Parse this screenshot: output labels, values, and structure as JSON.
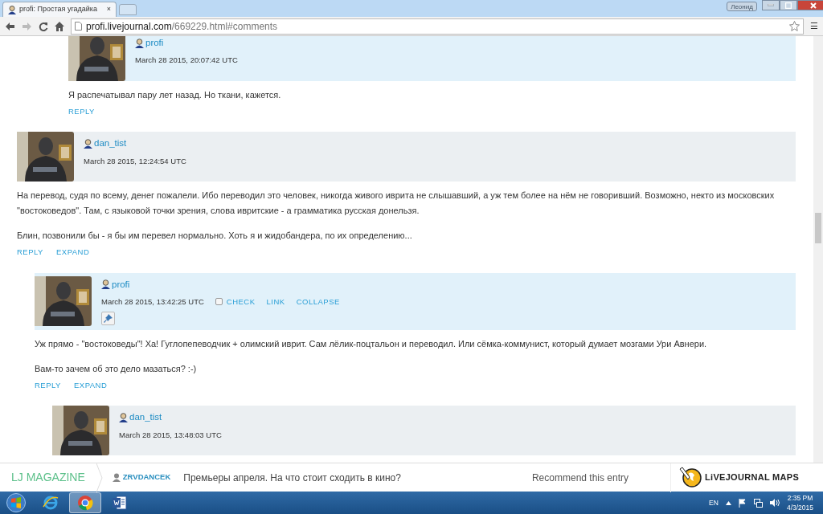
{
  "browser": {
    "tab": {
      "title": "profi: Простая угадайка",
      "close": "×"
    },
    "profile": "Леонид",
    "url": {
      "host": "profi.livejournal.com",
      "path": "/669229.html#comments"
    },
    "menu": "☰"
  },
  "thread_tail": {
    "user": "profi",
    "avatar": {
      "kind": "picture"
    },
    "date": "March 28 2015, 20:07:42 UTC",
    "color": "#e1f1fa",
    "paragraphs": [
      "Я распечатывал пару лет назад. Но ткани, кажется."
    ],
    "links": [
      "REPLY"
    ]
  },
  "comments": [
    {
      "user": "dan_tist",
      "avatar": {
        "kind": "picture"
      },
      "date": "March 28 2015, 12:24:54 UTC",
      "color": "#ebeff2",
      "paragraphs": [
        "На перевод, судя по всему, денег пожалели. Ибо переводил это человек, никогда живого иврита не слышавший, а уж тем более на нём не говоривший. Возможно, некто из московских \"востоковедов\". Там, с языковой точки зрения, слова ивритские - а грамматика русская донельзя.",
        "Блин, позвонили бы - я бы им перевел нормально. Хоть я и жидобандера, по их определению..."
      ],
      "links": [
        "REPLY",
        "EXPAND"
      ],
      "children": [
        {
          "user": "profi",
          "avatar": {
            "kind": "picture"
          },
          "date": "March 28 2015, 13:42:25 UTC",
          "color": "#e1f1fa",
          "actions": [
            {
              "kind": "check",
              "label": "CHECK",
              "checked": false
            },
            {
              "kind": "link",
              "label": "LINK"
            },
            {
              "kind": "link",
              "label": "COLLAPSE"
            }
          ],
          "pin": true,
          "paragraphs": [
            "Уж прямо - \"востоковеды\"! Ха! Гуглопепеводчик + олимский иврит. Сам лёлик-поцтальон и переводил. Или сёмка-коммунист, который думает мозгами Ури Авнери.",
            "Вам-то зачем об это дело мазаться? :-)"
          ],
          "links": [
            "REPLY",
            "EXPAND"
          ],
          "children": [
            {
              "user": "dan_tist",
              "avatar": {
                "kind": "picture"
              },
              "date": "March 28 2015, 13:48:03 UTC",
              "color": "#ebeff2"
            }
          ]
        }
      ]
    }
  ],
  "lj_bar": {
    "magazine": "LJ MAGAZINE",
    "author": "ZRVDANCEK",
    "headline": "Премьеры апреля. На что стоит сходить в кино?",
    "recommend": "Recommend this entry",
    "logo": "LiVEJOURNAL MAPS"
  },
  "taskbar": {
    "apps": [
      {
        "kind": "ie",
        "selected": false
      },
      {
        "kind": "chrome",
        "selected": true
      },
      {
        "kind": "word",
        "selected": false
      }
    ],
    "tray": {
      "language": "EN",
      "time": "2:35 PM",
      "date": "4/3/2015"
    }
  }
}
